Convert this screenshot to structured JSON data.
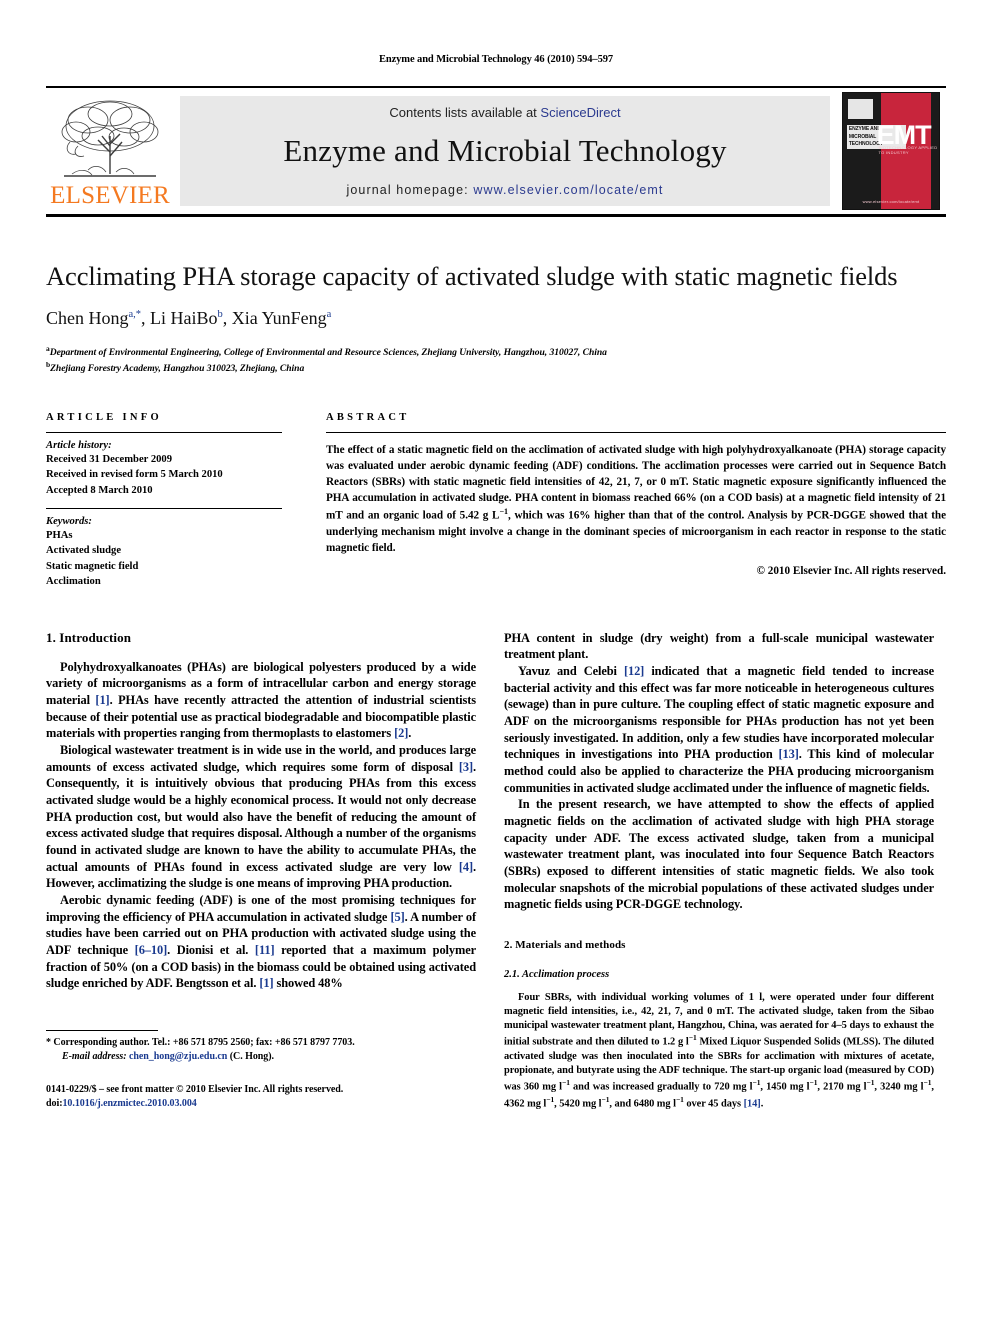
{
  "running_head": "Enzyme and Microbial Technology 46 (2010) 594–597",
  "masthead": {
    "publisher_name": "ELSEVIER",
    "contents_prefix": "Contents lists available at ",
    "contents_link": "ScienceDirect",
    "journal_title": "Enzyme and Microbial Technology",
    "homepage_prefix": "journal homepage: ",
    "homepage_url": "www.elsevier.com/locate/emt",
    "cover": {
      "journal_name_lines": "ENZYME AND MICROBIAL TECHNOLOGY",
      "acronym": "EMT",
      "subtitle": "BIOTECHNOLOGY APPLIED TO INDUSTRY",
      "url": "www.elsevier.com/locate/emt"
    }
  },
  "article": {
    "title": "Acclimating PHA storage capacity of activated sludge with static magnetic fields",
    "authors_html": "Chen Hong, Li HaiBo, Xia YunFeng",
    "authors": [
      {
        "name": "Chen Hong",
        "marks": "a,*"
      },
      {
        "name": "Li HaiBo",
        "marks": "b"
      },
      {
        "name": "Xia YunFeng",
        "marks": "a"
      }
    ],
    "affiliations": [
      {
        "mark": "a",
        "text": "Department of Environmental Engineering, College of Environmental and Resource Sciences, Zhejiang University, Hangzhou, 310027, China"
      },
      {
        "mark": "b",
        "text": "Zhejiang Forestry Academy, Hangzhou 310023, Zhejiang, China"
      }
    ]
  },
  "article_info": {
    "heading": "ARTICLE INFO",
    "history_label": "Article history:",
    "history": [
      "Received 31 December 2009",
      "Received in revised form 5 March 2010",
      "Accepted 8 March 2010"
    ],
    "keywords_label": "Keywords:",
    "keywords": [
      "PHAs",
      "Activated sludge",
      "Static magnetic field",
      "Acclimation"
    ]
  },
  "abstract": {
    "heading": "ABSTRACT",
    "text": "The effect of a static magnetic field on the acclimation of activated sludge with high polyhydroxyalkanoate (PHA) storage capacity was evaluated under aerobic dynamic feeding (ADF) conditions. The acclimation processes were carried out in Sequence Batch Reactors (SBRs) with static magnetic field intensities of 42, 21, 7, or 0 mT. Static magnetic exposure significantly influenced the PHA accumulation in activated sludge. PHA content in biomass reached 66% (on a COD basis) at a magnetic field intensity of 21 mT and an organic load of 5.42 g L−1, which was 16% higher than that of the control. Analysis by PCR-DGGE showed that the underlying mechanism might involve a change in the dominant species of microorganism in each reactor in response to the static magnetic field.",
    "copyright": "© 2010 Elsevier Inc. All rights reserved."
  },
  "sections": {
    "introduction_heading": "1. Introduction",
    "methods_heading": "2. Materials and methods",
    "acclimation_heading": "2.1. Acclimation process"
  },
  "body": {
    "left": {
      "p1": "Polyhydroxyalkanoates (PHAs) are biological polyesters produced by a wide variety of microorganisms as a form of intracellular carbon and energy storage material [1]. PHAs have recently attracted the attention of industrial scientists because of their potential use as practical biodegradable and biocompatible plastic materials with properties ranging from thermoplasts to elastomers [2].",
      "p2": "Biological wastewater treatment is in wide use in the world, and produces large amounts of excess activated sludge, which requires some form of disposal [3]. Consequently, it is intuitively obvious that producing PHAs from this excess activated sludge would be a highly economical process. It would not only decrease PHA production cost, but would also have the benefit of reducing the amount of excess activated sludge that requires disposal. Although a number of the organisms found in activated sludge are known to have the ability to accumulate PHAs, the actual amounts of PHAs found in excess activated sludge are very low [4]. However, acclimatizing the sludge is one means of improving PHA production.",
      "p3": "Aerobic dynamic feeding (ADF) is one of the most promising techniques for improving the efficiency of PHA accumulation in activated sludge [5]. A number of studies have been carried out on PHA production with activated sludge using the ADF technique [6–10]. Dionisi et al. [11] reported that a maximum polymer fraction of 50% (on a COD basis) in the biomass could be obtained using activated sludge enriched by ADF. Bengtsson et al. [1] showed 48%"
    },
    "right": {
      "p1": "PHA content in sludge (dry weight) from a full-scale municipal wastewater treatment plant.",
      "p2": "Yavuz and Celebi [12] indicated that a magnetic field tended to increase bacterial activity and this effect was far more noticeable in heterogeneous cultures (sewage) than in pure culture. The coupling effect of static magnetic exposure and ADF on the microorganisms responsible for PHAs production has not yet been seriously investigated. In addition, only a few studies have incorporated molecular techniques in investigations into PHA production [13]. This kind of molecular method could also be applied to characterize the PHA producing microorganism communities in activated sludge acclimated under the influence of magnetic fields.",
      "p3": "In the present research, we have attempted to show the effects of applied magnetic fields on the acclimation of activated sludge with high PHA storage capacity under ADF. The excess activated sludge, taken from a municipal wastewater treatment plant, was inoculated into four Sequence Batch Reactors (SBRs) exposed to different intensities of static magnetic fields. We also took molecular snapshots of the microbial populations of these activated sludges under magnetic fields using PCR-DGGE technology.",
      "p4": "Four SBRs, with individual working volumes of 1 l, were operated under four different magnetic field intensities, i.e., 42, 21, 7, and 0 mT. The activated sludge, taken from the Sibao municipal wastewater treatment plant, Hangzhou, China, was aerated for 4–5 days to exhaust the initial substrate and then diluted to 1.2 g l−1 Mixed Liquor Suspended Solids (MLSS). The diluted activated sludge was then inoculated into the SBRs for acclimation with mixtures of acetate, propionate, and butyrate using the ADF technique. The start-up organic load (measured by COD) was 360 mg l−1 and was increased gradually to 720 mg l−1, 1450 mg l−1, 2170 mg l−1, 3240 mg l−1, 4362 mg l−1, 5420 mg l−1, and 6480 mg l−1 over 45 days [14]."
    }
  },
  "footnotes": {
    "corresponding": "* Corresponding author. Tel.: +86 571 8795 2560; fax: +86 571 8797 7703.",
    "email_label": "E-mail address:",
    "email": "chen_hong@zju.edu.cn",
    "email_suffix": " (C. Hong).",
    "imprint_line1": "0141-0229/$ – see front matter © 2010 Elsevier Inc. All rights reserved.",
    "doi_label": "doi:",
    "doi": "10.1016/j.enzmictec.2010.03.004"
  },
  "colors": {
    "link": "#1a3a8f",
    "elsevier_orange": "#f47920",
    "cover_red": "#c8253c",
    "band_gray": "#e8e8e8"
  }
}
